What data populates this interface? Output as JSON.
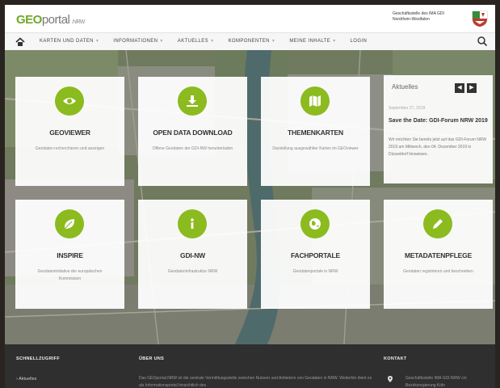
{
  "header": {
    "logo_geo": "GEO",
    "logo_portal": "portal",
    "logo_new": ".NRW",
    "org_line1": "Geschäftsstelle des IMA GDI",
    "org_line2": "Nordrhein-Westfalen"
  },
  "nav": {
    "items": [
      {
        "label": "KARTEN UND DATEN",
        "caret": "▾"
      },
      {
        "label": "INFORMATIONEN",
        "caret": "▾"
      },
      {
        "label": "AKTUELLES",
        "caret": "▾"
      },
      {
        "label": "KOMPONENTEN",
        "caret": "▾"
      },
      {
        "label": "MEINE INHALTE",
        "caret": "▾"
      },
      {
        "label": "LOGIN",
        "caret": ""
      }
    ]
  },
  "tiles": [
    {
      "title": "GEOVIEWER",
      "desc": "Geodaten recherchieren und anzeigen",
      "icon": "eye-icon"
    },
    {
      "title": "OPEN DATA DOWNLOAD",
      "desc": "Offene Geodaten der GDI-NW herunterladen",
      "icon": "download-icon"
    },
    {
      "title": "THEMENKARTEN",
      "desc": "Darstellung ausgewählter Karten im GEOviewer",
      "icon": "map-icon"
    },
    {
      "title": "INSPIRE",
      "desc": "Geodateninitiative der europäischen Kommission",
      "icon": "leaf-icon"
    },
    {
      "title": "GDI-NW",
      "desc": "Geodateninfrastruktur NRW",
      "icon": "info-icon"
    },
    {
      "title": "FACHPORTALE",
      "desc": "Geodatenportale in NRW",
      "icon": "globe-icon"
    },
    {
      "title": "METADATENPFLEGE",
      "desc": "Geodaten registrieren und beschreiben",
      "icon": "pencil-icon"
    }
  ],
  "news": {
    "title": "Aktuelles",
    "prev": "◀",
    "next": "▶",
    "date": "September 27, 2019",
    "headline": "Save the Date: GDI-Forum NRW 2019",
    "text": "Wir möchten Sie bereits jetzt auf das GDI-Forum NRW 2019 am Mittwoch, den 04. Dezember 2019 in Düsseldorf hinweisen."
  },
  "footer": {
    "quick_title": "SCHNELLZUGRIFF",
    "about_title": "ÜBER UNS",
    "contact_title": "KONTAKT",
    "quick_link": "Aktuelles",
    "about_text": "Das GEOportal.NRW ist die zentrale Vermittlungsstelle zwischen Nutzern und Anbietern von Geodaten in NRW. Weiterhin dient es als Informationsportal hinsichtlich des",
    "contact_text": "Geschäftsstelle IMA GDI.NRW c/o Bezirksregierung Köln"
  },
  "colors": {
    "accent": "#8bbb1e",
    "logo_green": "#6ea82a",
    "footer_bg": "#2f2f2f"
  }
}
